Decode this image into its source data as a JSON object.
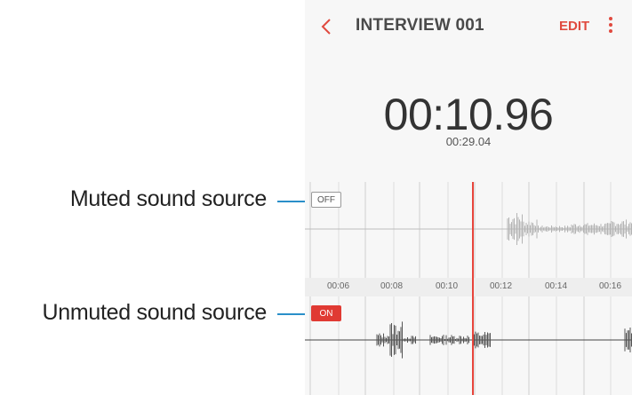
{
  "callouts": {
    "muted": "Muted sound source",
    "unmuted": "Unmuted sound source"
  },
  "header": {
    "back_icon": "chevron-left-icon",
    "title": "INTERVIEW 001",
    "edit_label": "EDIT",
    "more_icon": "more-vert-icon"
  },
  "playback": {
    "current_time": "00:10.96",
    "total_time": "00:29.04"
  },
  "tracks": [
    {
      "toggle_label": "OFF",
      "state": "muted"
    },
    {
      "toggle_label": "ON",
      "state": "unmuted"
    }
  ],
  "timeline": {
    "labels": [
      "00:06",
      "00:08",
      "00:10",
      "00:12",
      "00:14",
      "00:16"
    ]
  },
  "colors": {
    "accent": "#e04a3f",
    "callout_line": "#2a8fc9",
    "on_badge": "#e03a33",
    "background": "#f7f7f7"
  }
}
